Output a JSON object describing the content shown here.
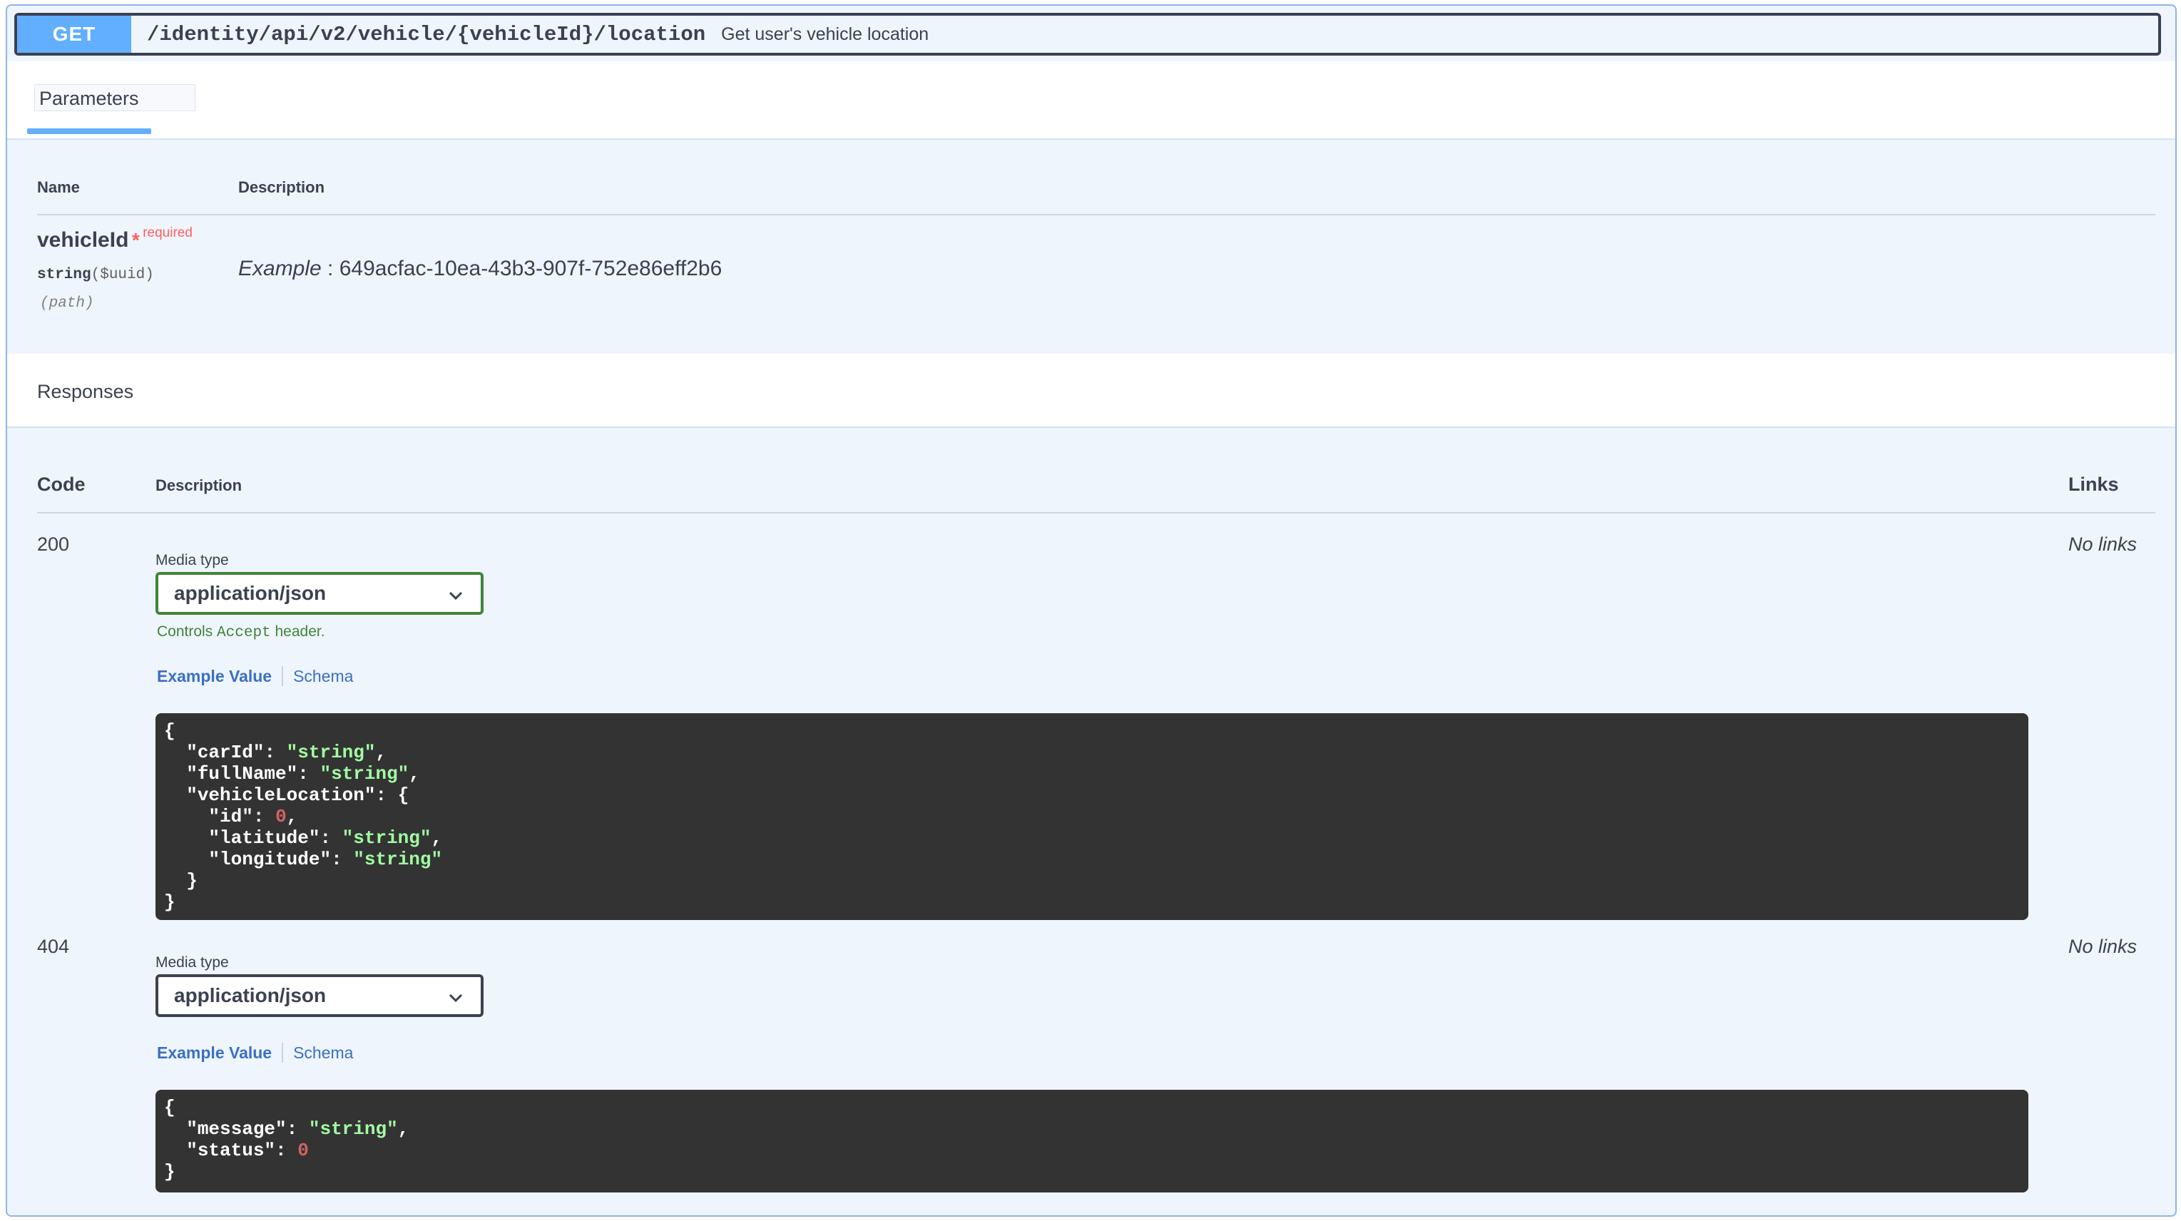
{
  "endpoint": {
    "method": "GET",
    "path": "/identity/api/v2/vehicle/{vehicleId}/location",
    "summary": "Get user's vehicle location",
    "method_color": "#61affe"
  },
  "parameters": {
    "tab_label": "Parameters",
    "headers": {
      "name": "Name",
      "description": "Description"
    },
    "items": [
      {
        "name": "vehicleId",
        "required_mark": "*",
        "required_label": "required",
        "type": "string",
        "format": "($uuid)",
        "in": "(path)",
        "example_label": "Example",
        "example_sep": " : ",
        "example_value": "649acfac-10ea-43b3-907f-752e86eff2b6"
      }
    ]
  },
  "responses": {
    "title": "Responses",
    "headers": {
      "code": "Code",
      "description": "Description",
      "links": "Links"
    },
    "items": [
      {
        "code": "200",
        "links": "No links",
        "media_type_label": "Media type",
        "media_type_value": "application/json",
        "controls_pre": "Controls ",
        "controls_mono": "Accept",
        "controls_post": " header.",
        "example_tab": "Example Value",
        "schema_tab": "Schema",
        "example_json": {
          "open": "{",
          "carId_key": "\"carId\"",
          "carId_val": "\"string\"",
          "fullName_key": "\"fullName\"",
          "fullName_val": "\"string\"",
          "vl_key": "\"vehicleLocation\"",
          "vl_open": "{",
          "id_key": "\"id\"",
          "id_val": "0",
          "lat_key": "\"latitude\"",
          "lat_val": "\"string\"",
          "lon_key": "\"longitude\"",
          "lon_val": "\"string\"",
          "vl_close": "}",
          "close": "}"
        }
      },
      {
        "code": "404",
        "links": "No links",
        "media_type_label": "Media type",
        "media_type_value": "application/json",
        "example_tab": "Example Value",
        "schema_tab": "Schema",
        "example_json": {
          "open": "{",
          "message_key": "\"message\"",
          "message_val": "\"string\"",
          "status_key": "\"status\"",
          "status_val": "0",
          "close": "}"
        }
      }
    ]
  },
  "colors": {
    "accent_get": "#61affe",
    "required": "#ff6060",
    "media_border_active": "#41843a",
    "json_string": "#a2fca2",
    "json_number": "#d36363",
    "code_bg": "#333333"
  }
}
